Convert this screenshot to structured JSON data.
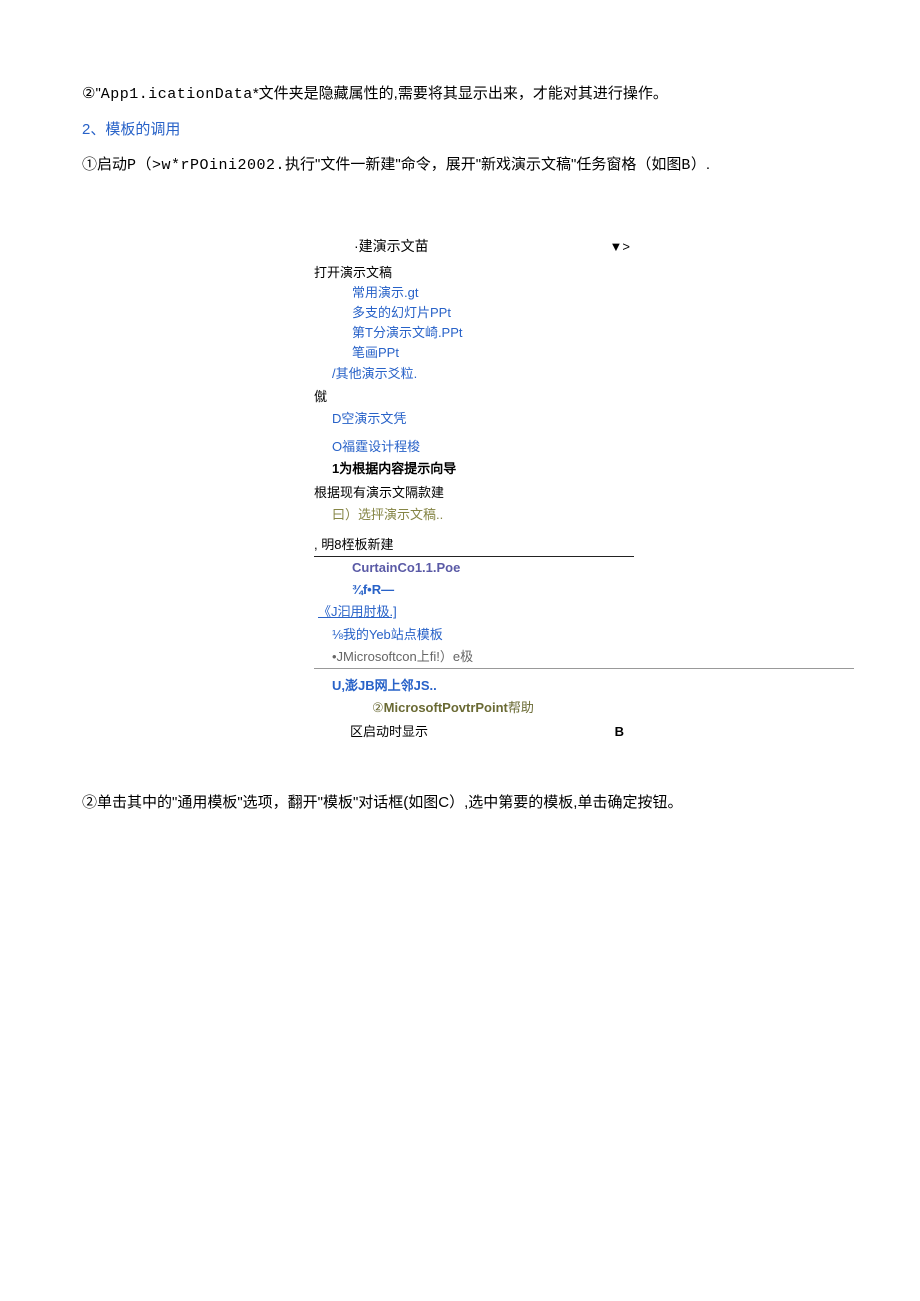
{
  "para1": {
    "prefix": "②\"",
    "mono": "App1.icationData",
    "suffix": "*文件夹是隐藏属性的,需要将其显示出来，才能对其进行操作。"
  },
  "heading2": "2、模板的调用",
  "para2": {
    "a": "①启动",
    "mono1": "P（>w*rPOini2002.",
    "b": "执行\"文件一新建\"命令，展开\"新戏演示文稿\"任务窗格（如图",
    "mono2": "B",
    "c": "）."
  },
  "panel": {
    "header_left": "·建演示文苗",
    "header_right": "▼>",
    "open_title": "打开演示文稿",
    "recent": [
      "常用演示.gt",
      "多支的幻灯片PPt",
      "第T分演示文崎.PPt",
      "笔画PPt"
    ],
    "other_open": "/其他演示爻粒.",
    "new_title": "僦",
    "new_blank": "D空演示文凭",
    "new_design": "O福霆设计程梭",
    "new_wizard": "1为根据内容提示向导",
    "from_exist_title": "根据现有演示文隔款建",
    "from_exist_item": "曰）选抨演示文稿..",
    "tmpl_title": ", 明8桎板新建",
    "tmpl_items": {
      "curtain": "CurtainCo1.1.Poe",
      "ref": "¾f•R—",
      "general": "《J汩用肘极.]",
      "mysite": "⅛我的Yeb站点模板",
      "mscon": "•JMicrosoftcon上fi!）e极"
    },
    "network": "U,澎JB网上邻JS..",
    "help_prefix": "②",
    "help_main": "MicrosoftPovtrPoint",
    "help_suffix": "帮助",
    "footer_left": "区启动时显示",
    "footer_right": "B"
  },
  "para3": "②单击其中的\"通用模板\"选项，翻开\"模板\"对话框(如图C）,选中第要的模板,单击确定按钮。"
}
